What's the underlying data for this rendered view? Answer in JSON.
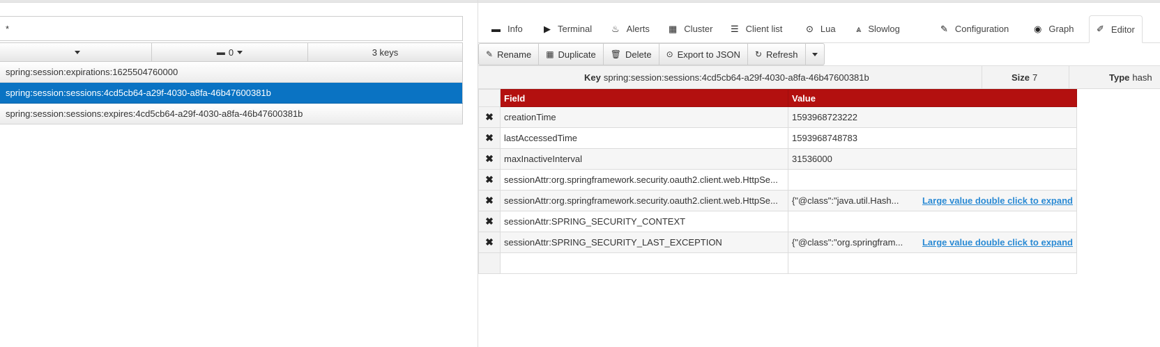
{
  "search": {
    "value": "*"
  },
  "filters": {
    "db": "0",
    "keys_count": "3 keys"
  },
  "keys": [
    {
      "name": "spring:session:expirations:1625504760000",
      "selected": false
    },
    {
      "name": "spring:session:sessions:4cd5cb64-a29f-4030-a8fa-46b47600381b",
      "selected": true
    },
    {
      "name": "spring:session:sessions:expires:4cd5cb64-a29f-4030-a8fa-46b47600381b",
      "selected": false
    }
  ],
  "tabs": [
    {
      "label": "Info",
      "icon": "server-icon",
      "glyph": "▬"
    },
    {
      "label": "Terminal",
      "icon": "terminal-icon",
      "glyph": "▶"
    },
    {
      "label": "Alerts",
      "icon": "fire-icon",
      "glyph": "♨"
    },
    {
      "label": "Cluster",
      "icon": "th-icon",
      "glyph": "▦"
    },
    {
      "label": "Client list",
      "icon": "list-icon",
      "glyph": "☰"
    },
    {
      "label": "Lua",
      "icon": "play-circle-icon",
      "glyph": "⊙"
    },
    {
      "label": "Slowlog",
      "icon": "road-icon",
      "glyph": "⩓"
    },
    {
      "label": "Configuration",
      "icon": "wrench-icon",
      "glyph": "✎"
    },
    {
      "label": "Graph",
      "icon": "eye-icon",
      "glyph": "◉"
    },
    {
      "label": "Editor",
      "icon": "edit-icon",
      "glyph": "✐"
    }
  ],
  "toolbar": {
    "rename": "Rename",
    "duplicate": "Duplicate",
    "delete": "Delete",
    "export": "Export to JSON",
    "refresh": "Refresh"
  },
  "key_info": {
    "key_label": "Key",
    "key_value": "spring:session:sessions:4cd5cb64-a29f-4030-a8fa-46b47600381b",
    "size_label": "Size",
    "size_value": "7",
    "type_label": "Type",
    "type_value": "hash"
  },
  "table": {
    "headers": {
      "field": "Field",
      "value": "Value"
    },
    "rows": [
      {
        "field": "creationTime",
        "value": "1593968723222",
        "expand": ""
      },
      {
        "field": "lastAccessedTime",
        "value": "1593968748783",
        "expand": ""
      },
      {
        "field": "maxInactiveInterval",
        "value": "31536000",
        "expand": ""
      },
      {
        "field": "sessionAttr:org.springframework.security.oauth2.client.web.HttpSe...",
        "value": "",
        "expand": ""
      },
      {
        "field": "sessionAttr:org.springframework.security.oauth2.client.web.HttpSe...",
        "value": "{\"@class\":\"java.util.Hash...",
        "expand": "Large value double click to expand"
      },
      {
        "field": "sessionAttr:SPRING_SECURITY_CONTEXT",
        "value": "",
        "expand": ""
      },
      {
        "field": "sessionAttr:SPRING_SECURITY_LAST_EXCEPTION",
        "value": "{\"@class\":\"org.springfram...",
        "expand": "Large value double click to expand"
      }
    ]
  },
  "colors": {
    "accent": "#0a73c3",
    "table_header": "#b3100f",
    "link": "#2a8ad4"
  }
}
